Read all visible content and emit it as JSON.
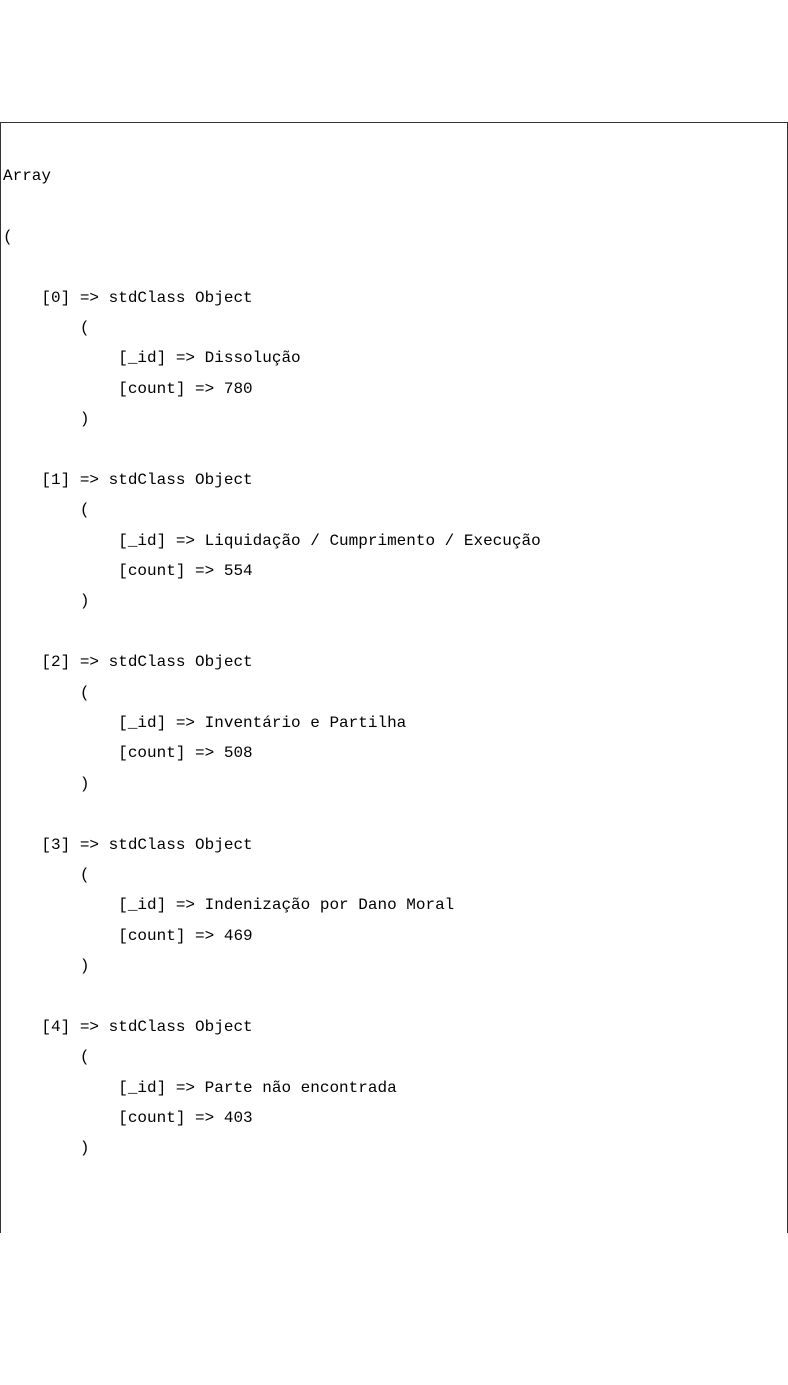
{
  "header": {
    "arrayLabel": "Array",
    "openParen": "(",
    "closeParen": ")"
  },
  "objectLabel": "stdClass Object",
  "arrow": "=>",
  "keyId": "[_id]",
  "keyCount": "[count]",
  "items": [
    {
      "index": "[0]",
      "id": "Dissolução",
      "count": "780"
    },
    {
      "index": "[1]",
      "id": "Liquidação / Cumprimento / Execução",
      "count": "554"
    },
    {
      "index": "[2]",
      "id": "Inventário e Partilha",
      "count": "508"
    },
    {
      "index": "[3]",
      "id": "Indenização por Dano Moral",
      "count": "469"
    },
    {
      "index": "[4]",
      "id": "Parte não encontrada",
      "count": "403"
    }
  ]
}
